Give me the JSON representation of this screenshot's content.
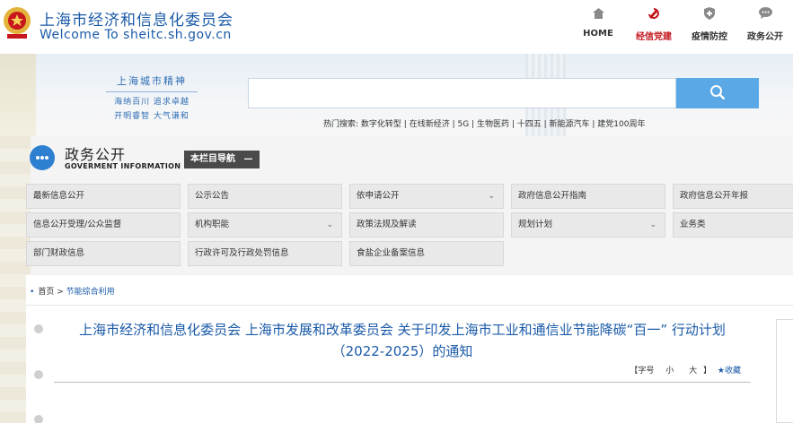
{
  "header": {
    "site_name": "上海市经济和信息化委员会",
    "site_domain": "Welcome To sheitc.sh.gov.cn",
    "nav": [
      {
        "label": "HOME",
        "icon": "home-icon",
        "active": false
      },
      {
        "label": "经信党建",
        "icon": "party-emblem-icon",
        "active": true
      },
      {
        "label": "疫情防控",
        "icon": "shield-icon",
        "active": false
      },
      {
        "label": "政务公开",
        "icon": "chat-icon",
        "active": false
      }
    ]
  },
  "banner": {
    "spirit_title": "上海城市精神",
    "spirit_line1": "海纳百川 追求卓越",
    "spirit_line2": "开明睿智 大气谦和",
    "search_value": "",
    "hot_label": "热门搜索:",
    "hot_items": [
      "数字化转型",
      "在线新经济",
      "5G",
      "生物医药",
      "十四五",
      "新能源汽车",
      "建党100周年"
    ]
  },
  "section": {
    "title": "政务公开",
    "subtitle": "GOVERMENT INFORMATION",
    "col_nav_label": "本栏目导航",
    "col_nav_symbol": "—"
  },
  "grid": {
    "items": [
      {
        "label": "最新信息公开",
        "dropdown": false
      },
      {
        "label": "公示公告",
        "dropdown": false
      },
      {
        "label": "依申请公开",
        "dropdown": true
      },
      {
        "label": "政府信息公开指南",
        "dropdown": false
      },
      {
        "label": "政府信息公开年报",
        "dropdown": false
      },
      {
        "label": "信息公开受理/公众监督",
        "dropdown": false
      },
      {
        "label": "机构职能",
        "dropdown": true
      },
      {
        "label": "政策法规及解读",
        "dropdown": false
      },
      {
        "label": "规划计划",
        "dropdown": true
      },
      {
        "label": "业务类",
        "dropdown": false
      },
      {
        "label": "部门财政信息",
        "dropdown": false
      },
      {
        "label": "行政许可及行政处罚信息",
        "dropdown": false
      },
      {
        "label": "食盐企业备案信息",
        "dropdown": false
      }
    ]
  },
  "breadcrumb": {
    "home": "首页",
    "separator": ">",
    "current": "节能综合利用"
  },
  "article": {
    "title": "上海市经济和信息化委员会 上海市发展和改革委员会 关于印发上海市工业和通信业节能降碳“百一” 行动计划（2022-2025）的通知",
    "font_label": "【字号",
    "font_small": "小",
    "font_large": "大",
    "font_close": "】",
    "favorite": "★收藏"
  }
}
